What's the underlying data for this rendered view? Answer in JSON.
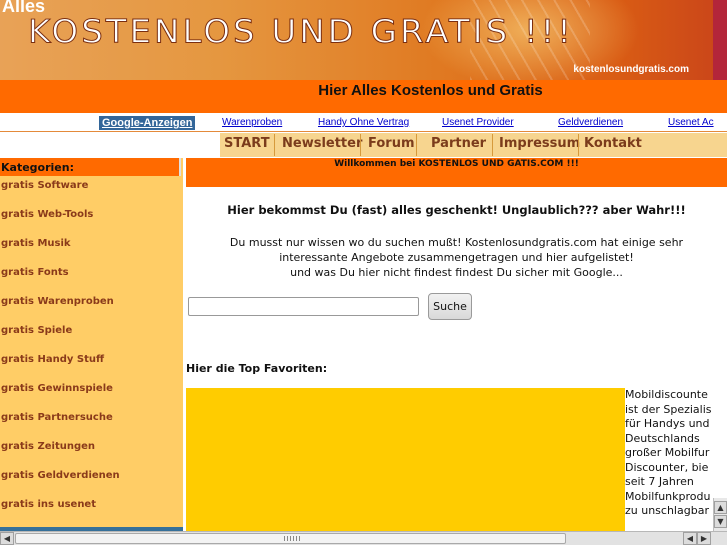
{
  "banner": {
    "corner_label": "Alles",
    "title": "KOSTENLOS UND GRATIS !!!",
    "domain": "kostenlosundgratis.com"
  },
  "headline": "Hier Alles Kostenlos und Gratis",
  "ads": {
    "label": "Google-Anzeigen",
    "links": [
      "Warenproben",
      "Handy Ohne Vertrag",
      "Usenet Provider",
      "Geldverdienen",
      "Usenet Ac"
    ]
  },
  "nav": [
    "START",
    "Newsletter",
    "Forum",
    "Partner",
    "Impressum",
    "Kontakt"
  ],
  "sidebar": {
    "heading": "Kategorien:",
    "items": [
      "gratis Software",
      "gratis Web-Tools",
      "gratis Musik",
      "gratis Fonts",
      "gratis Warenproben",
      "gratis Spiele",
      "gratis Handy Stuff",
      "gratis Gewinnspiele",
      "gratis Partnersuche",
      "gratis Zeitungen",
      "gratis Geldverdienen",
      "gratis ins usenet"
    ]
  },
  "main": {
    "welcome": "Willkommen bei KOSTENLOS UND GATIS.COM !!!",
    "lead": "Hier bekommst Du (fast) alles geschenkt! Unglaublich??? aber Wahr!!!",
    "paragraph_lines": [
      "Du musst nur wissen wo du suchen mußt! Kostenlosundgratis.com hat einige sehr",
      "interessante Angebote zusammengetragen und hier aufgelistet!",
      "und was Du hier nicht findest findest Du sicher mit Google..."
    ],
    "search": {
      "value": "",
      "button": "Suche"
    },
    "favorites_heading": "Hier die Top Favoriten:",
    "favorite_text_lines": [
      "Mobildiscounte",
      "ist der Spezialis",
      "für Handys und",
      "Deutschlands",
      "großer Mobilfur",
      "Discounter, bie",
      "seit 7 Jahren",
      "Mobilfunkprodu",
      "zu unschlagbar"
    ]
  },
  "colors": {
    "orange_bar": "#ff6a00",
    "sidebar_bg": "#ffcd66",
    "nav_bg": "#f7d58f",
    "favorite_box": "#ffcc00",
    "link": "#0000cc"
  }
}
